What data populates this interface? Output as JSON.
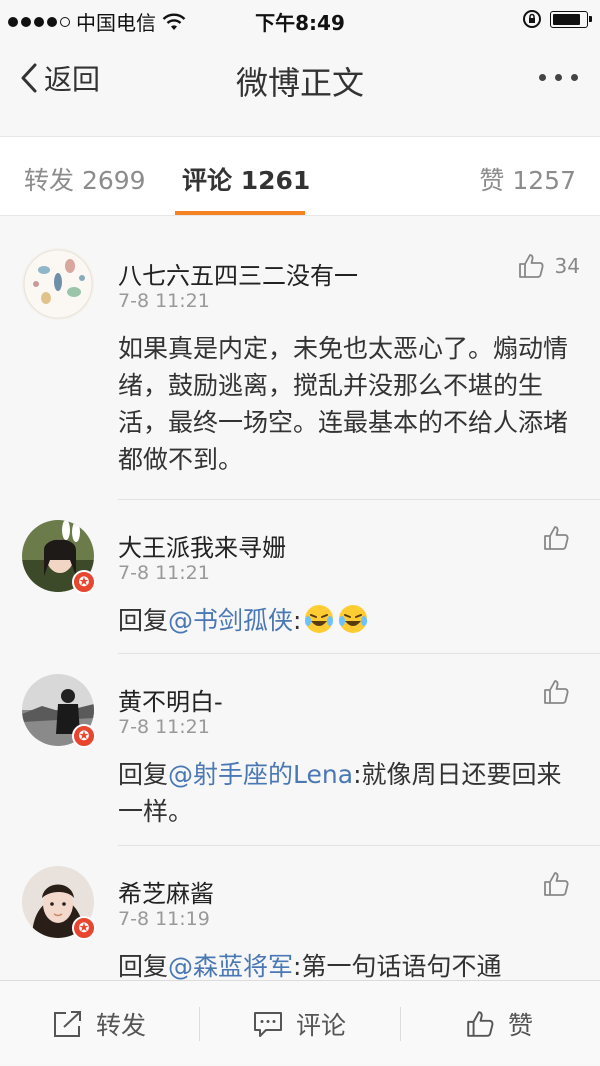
{
  "status_bar": {
    "carrier": "中国电信",
    "time": "下午8:49",
    "signal_strength": 4,
    "battery_level": 0.85
  },
  "nav": {
    "back_label": "返回",
    "title": "微博正文"
  },
  "tabs": {
    "repost": "转发 2699",
    "comments": "评论 1261",
    "likes": "赞 1257"
  },
  "comments": [
    {
      "name": "八七六五四三二没有一",
      "time": "7-8 11:21",
      "likes": "34",
      "text": "如果真是内定，未免也太恶心了。煽动情绪，鼓励逃离，搅乱并没那么不堪的生活，最终一场空。连最基本的不给人添堵都做不到。"
    },
    {
      "name": "大王派我来寻姗",
      "time": "7-8 11:21",
      "likes": "",
      "reply_prefix": "回复",
      "mention": "@书剑孤侠",
      "text": ":"
    },
    {
      "name": "黄不明白-",
      "time": "7-8 11:21",
      "likes": "",
      "reply_prefix": "回复",
      "mention": "@射手座的Lena",
      "text": ":就像周日还要回来一样。"
    },
    {
      "name": "希芝麻酱",
      "time": "7-8 11:19",
      "likes": "",
      "reply_prefix": "回复",
      "mention": "@森蓝将军",
      "text": ":第一句话语句不通"
    }
  ],
  "bottom_bar": {
    "repost": "转发",
    "comment": "评论",
    "like": "赞"
  },
  "colors": {
    "accent": "#f58220",
    "mention": "#4a78b5",
    "badge": "#e8472f"
  }
}
